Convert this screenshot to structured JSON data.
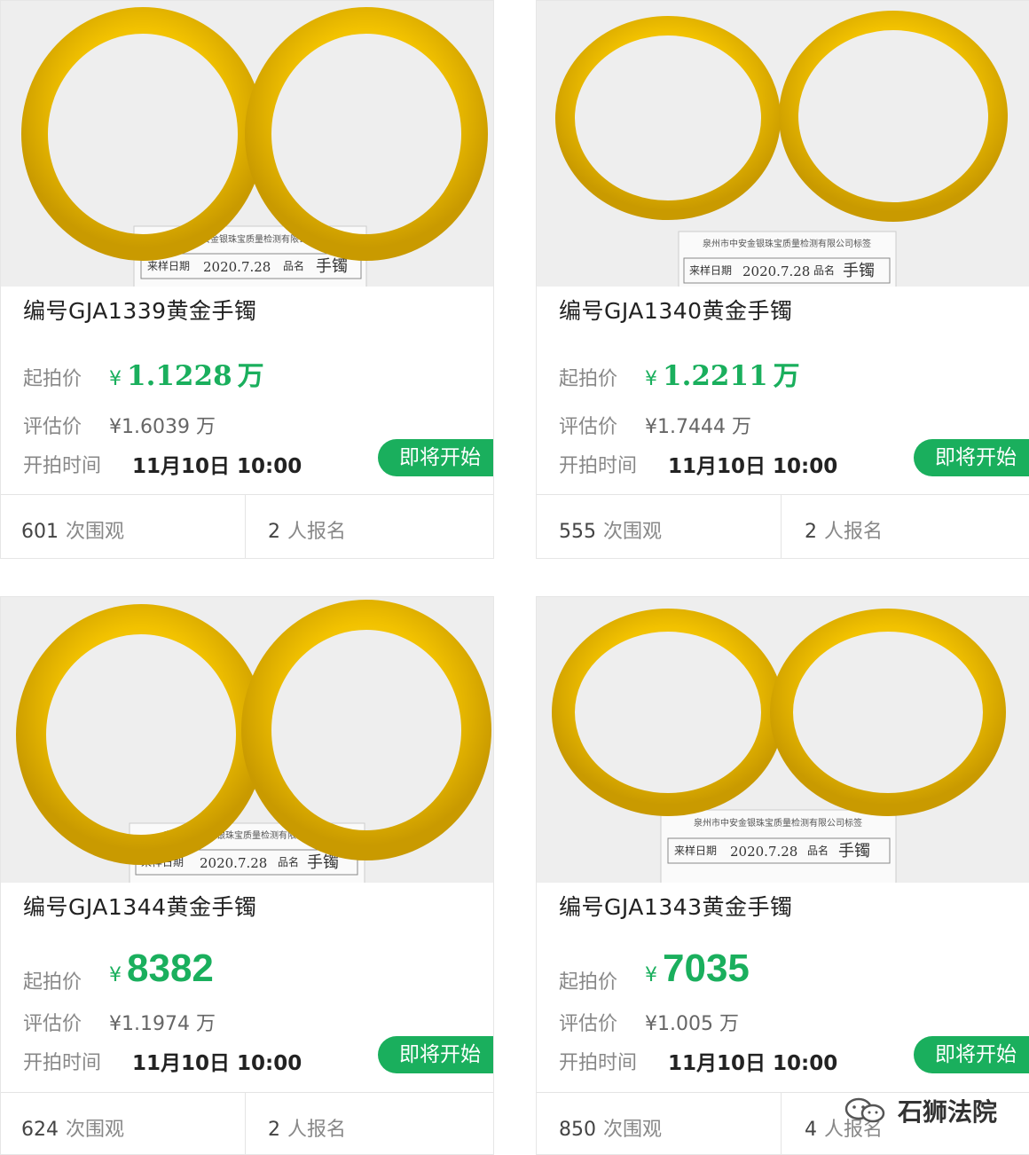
{
  "labels": {
    "start_price": "起拍价",
    "eval_price": "评估价",
    "start_time": "开拍时间",
    "views_suffix": "次围观",
    "signups_suffix": "人报名"
  },
  "lots": [
    {
      "title": "编号GJA1339黄金手镯",
      "currency": "¥",
      "start_price": "1.1228",
      "start_unit": "万",
      "eval_price": "¥1.6039 万",
      "start_time": "11月10日 10:00",
      "status": "即将开始",
      "views": "601",
      "signups": "2"
    },
    {
      "title": "编号GJA1340黄金手镯",
      "currency": "¥",
      "start_price": "1.2211",
      "start_unit": "万",
      "eval_price": "¥1.7444 万",
      "start_time": "11月10日 10:00",
      "status": "即将开始",
      "views": "555",
      "signups": "2"
    },
    {
      "title": "编号GJA1344黄金手镯",
      "currency": "¥",
      "start_price": "8382",
      "start_unit": "",
      "eval_price": "¥1.1974 万",
      "start_time": "11月10日 10:00",
      "status": "即将开始",
      "views": "624",
      "signups": "2"
    },
    {
      "title": "编号GJA1343黄金手镯",
      "currency": "¥",
      "start_price": "7035",
      "start_unit": "",
      "eval_price": "¥1.005 万",
      "start_time": "11月10日 10:00",
      "status": "即将开始",
      "views": "850",
      "signups": "4"
    }
  ],
  "photo_label": {
    "header": "泉州市中安金银珠宝质量检测有限公司标签",
    "field_date": "来样日期",
    "field_name": "品名",
    "date_values": [
      "2020.7.28",
      "2020.7.28",
      "2020.7.28",
      "2020.7.28"
    ],
    "name_value": "手镯"
  },
  "watermark": {
    "text": "石狮法院",
    "icon": "wechat-icon"
  },
  "colors": {
    "accent": "#1aaf5d",
    "gold": "#f2c200",
    "gold_dark": "#c99a00"
  }
}
